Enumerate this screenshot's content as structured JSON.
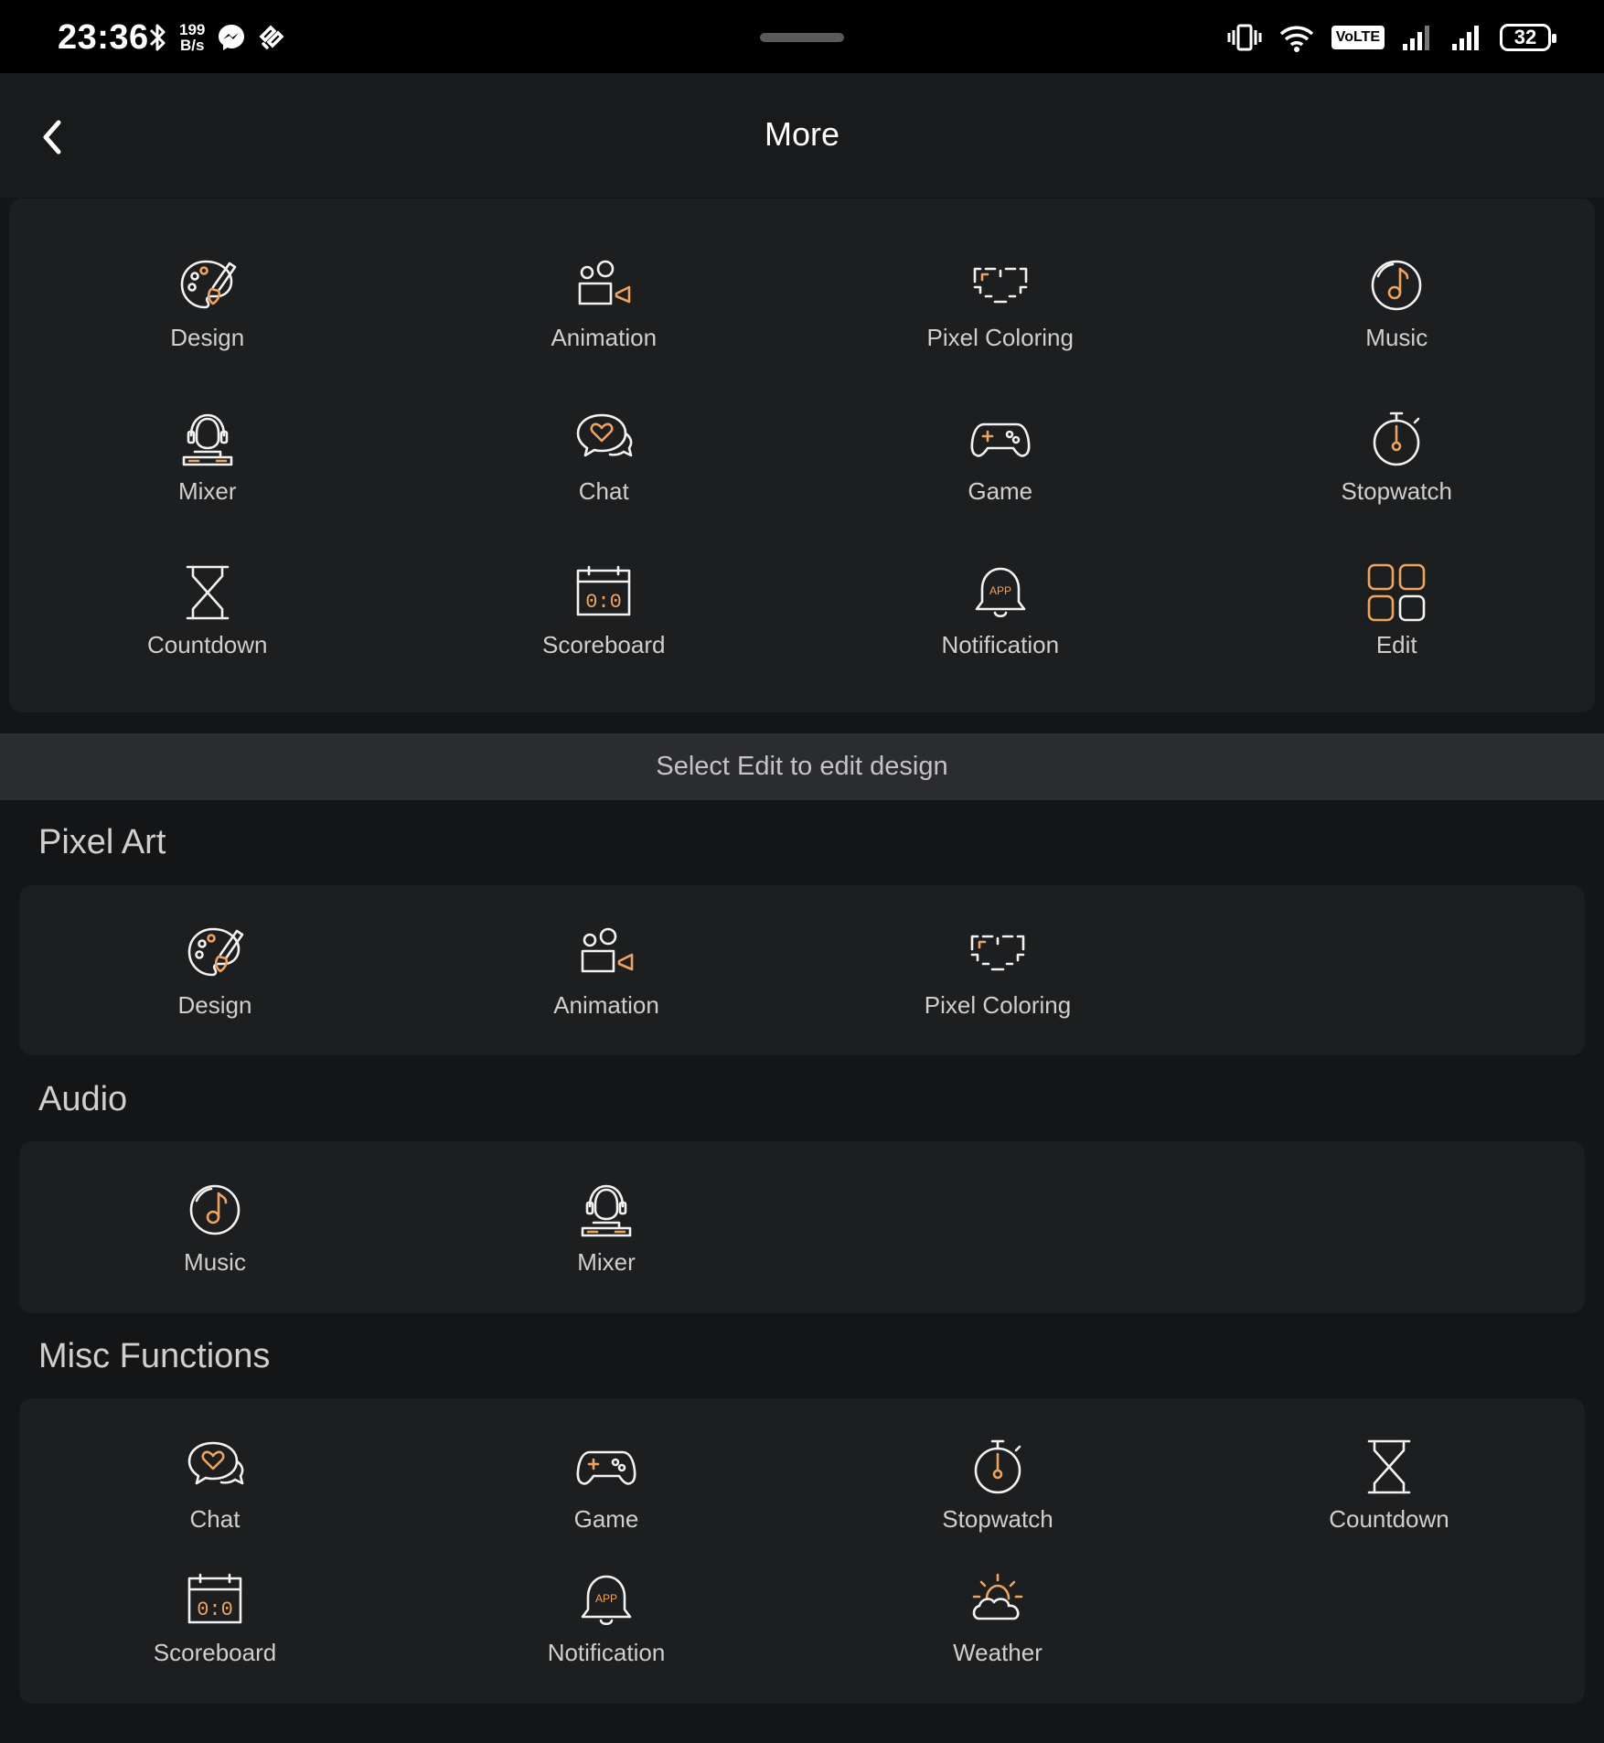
{
  "status_bar": {
    "time": "23:36",
    "speed_top": "199",
    "speed_bottom": "B/s",
    "volte": "VoLTE",
    "battery": "32",
    "icons": [
      "bluetooth-icon",
      "messenger-icon",
      "app-icon",
      "vibrate-icon",
      "wifi-icon",
      "signal-icon",
      "signal-icon",
      "battery-icon"
    ]
  },
  "header": {
    "title": "More",
    "back_icon": "chevron-left-icon"
  },
  "favorites": {
    "items": [
      {
        "label": "Design",
        "icon": "palette"
      },
      {
        "label": "Animation",
        "icon": "animation"
      },
      {
        "label": "Pixel Coloring",
        "icon": "pixelheart"
      },
      {
        "label": "Music",
        "icon": "music"
      },
      {
        "label": "Mixer",
        "icon": "mixer"
      },
      {
        "label": "Chat",
        "icon": "chat"
      },
      {
        "label": "Game",
        "icon": "game"
      },
      {
        "label": "Stopwatch",
        "icon": "stopwatch"
      },
      {
        "label": "Countdown",
        "icon": "countdown"
      },
      {
        "label": "Scoreboard",
        "icon": "scoreboard"
      },
      {
        "label": "Notification",
        "icon": "notification"
      },
      {
        "label": "Edit",
        "icon": "edit"
      }
    ]
  },
  "hint": "Select Edit to edit design",
  "sections": [
    {
      "title": "Pixel Art",
      "items": [
        {
          "label": "Design",
          "icon": "palette"
        },
        {
          "label": "Animation",
          "icon": "animation"
        },
        {
          "label": "Pixel Coloring",
          "icon": "pixelheart"
        }
      ]
    },
    {
      "title": "Audio",
      "items": [
        {
          "label": "Music",
          "icon": "music"
        },
        {
          "label": "Mixer",
          "icon": "mixer"
        }
      ]
    },
    {
      "title": "Misc Functions",
      "items": [
        {
          "label": "Chat",
          "icon": "chat"
        },
        {
          "label": "Game",
          "icon": "game"
        },
        {
          "label": "Stopwatch",
          "icon": "stopwatch"
        },
        {
          "label": "Countdown",
          "icon": "countdown"
        },
        {
          "label": "Scoreboard",
          "icon": "scoreboard"
        },
        {
          "label": "Notification",
          "icon": "notification"
        },
        {
          "label": "Weather",
          "icon": "weather"
        }
      ]
    }
  ],
  "icon_text": {
    "scoreboard": "0:0",
    "notification": "APP"
  },
  "colors": {
    "accent": "#f0a35e",
    "background": "#141516",
    "card": "#1d1e1f",
    "hint_bar": "#2a2c30"
  }
}
